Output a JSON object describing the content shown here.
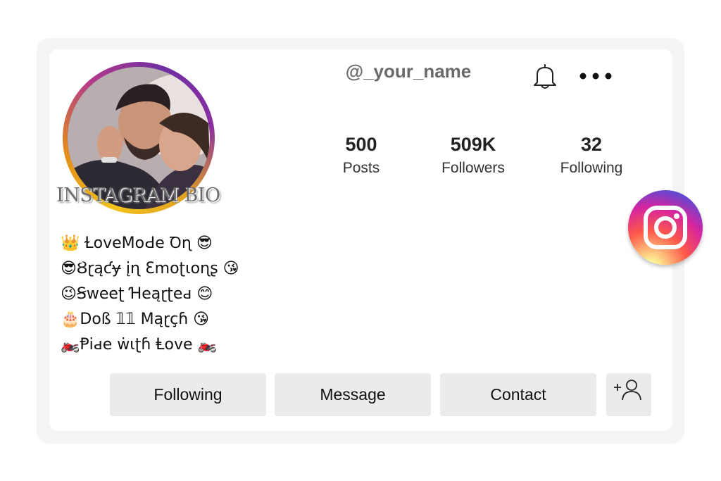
{
  "profile": {
    "username": "@_your_name",
    "avatar_caption": "INSTAGRAM BIO"
  },
  "stats": [
    {
      "value": "500",
      "label": "Posts"
    },
    {
      "value": "509K",
      "label": "Followers"
    },
    {
      "value": "32",
      "label": "Following"
    }
  ],
  "bio": [
    "👑 ⱢoveMoԀe Ꝺɳ 😎",
    "😎Ȣɽąƈɏ įɳ Ɛmoʈɩoɳʂ 😘",
    "😉Ꞩweeʈ Ɦeąɽʈeԁ 😊",
    "🎂Doß 𝟙𝟙 Mąɽçɦ 😘",
    "🏍️Ᵽiԁe ẇɩʈɦ Ⱡove 🏍️"
  ],
  "buttons": {
    "following": "Following",
    "message": "Message",
    "contact": "Contact"
  },
  "icons": {
    "notification": "bell-icon",
    "more": "more-icon",
    "add_user": "add-user-icon",
    "brand": "instagram-icon"
  },
  "colors": {
    "button_bg": "#ebebeb",
    "card_bg": "#f4f4f4",
    "username": "#6a6a6a",
    "ring_gold": "#f4c21d",
    "ring_purple": "#6f2fa3"
  }
}
